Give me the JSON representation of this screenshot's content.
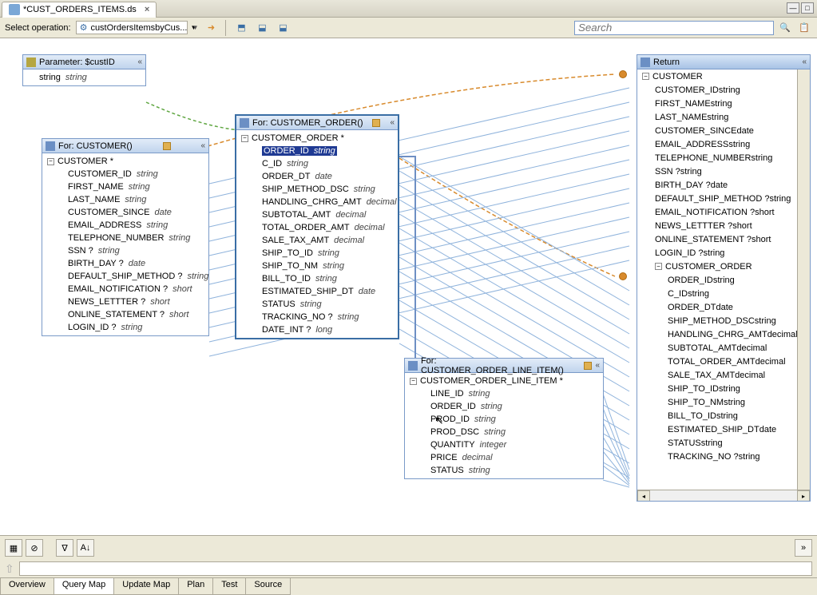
{
  "tab": {
    "title": "*CUST_ORDERS_ITEMS.ds"
  },
  "toolbar": {
    "select_label": "Select operation:",
    "operation": "custOrdersItemsbyCus...",
    "search_placeholder": "Search"
  },
  "panels": {
    "param": {
      "title": "Parameter: $custID",
      "rows": [
        {
          "name": "string",
          "type": "string"
        }
      ]
    },
    "customer": {
      "title": "For: CUSTOMER()",
      "root": "CUSTOMER *",
      "fields": [
        {
          "name": "CUSTOMER_ID",
          "type": "string"
        },
        {
          "name": "FIRST_NAME",
          "type": "string"
        },
        {
          "name": "LAST_NAME",
          "type": "string"
        },
        {
          "name": "CUSTOMER_SINCE",
          "type": "date"
        },
        {
          "name": "EMAIL_ADDRESS",
          "type": "string"
        },
        {
          "name": "TELEPHONE_NUMBER",
          "type": "string"
        },
        {
          "name": "SSN ?",
          "type": "string"
        },
        {
          "name": "BIRTH_DAY ?",
          "type": "date"
        },
        {
          "name": "DEFAULT_SHIP_METHOD ?",
          "type": "string"
        },
        {
          "name": "EMAIL_NOTIFICATION ?",
          "type": "short"
        },
        {
          "name": "NEWS_LETTTER ?",
          "type": "short"
        },
        {
          "name": "ONLINE_STATEMENT ?",
          "type": "short"
        },
        {
          "name": "LOGIN_ID ?",
          "type": "string"
        }
      ]
    },
    "order": {
      "title": "For: CUSTOMER_ORDER()",
      "root": "CUSTOMER_ORDER *",
      "fields": [
        {
          "name": "ORDER_ID",
          "type": "string",
          "selected": true
        },
        {
          "name": "C_ID",
          "type": "string"
        },
        {
          "name": "ORDER_DT",
          "type": "date"
        },
        {
          "name": "SHIP_METHOD_DSC",
          "type": "string"
        },
        {
          "name": "HANDLING_CHRG_AMT",
          "type": "decimal"
        },
        {
          "name": "SUBTOTAL_AMT",
          "type": "decimal"
        },
        {
          "name": "TOTAL_ORDER_AMT",
          "type": "decimal"
        },
        {
          "name": "SALE_TAX_AMT",
          "type": "decimal"
        },
        {
          "name": "SHIP_TO_ID",
          "type": "string"
        },
        {
          "name": "SHIP_TO_NM",
          "type": "string"
        },
        {
          "name": "BILL_TO_ID",
          "type": "string"
        },
        {
          "name": "ESTIMATED_SHIP_DT",
          "type": "date"
        },
        {
          "name": "STATUS",
          "type": "string"
        },
        {
          "name": "TRACKING_NO ?",
          "type": "string"
        },
        {
          "name": "DATE_INT ?",
          "type": "long"
        }
      ]
    },
    "lineitem": {
      "title": "For: CUSTOMER_ORDER_LINE_ITEM()",
      "root": "CUSTOMER_ORDER_LINE_ITEM *",
      "fields": [
        {
          "name": "LINE_ID",
          "type": "string"
        },
        {
          "name": "ORDER_ID",
          "type": "string"
        },
        {
          "name": "PROD_ID",
          "type": "string"
        },
        {
          "name": "PROD_DSC",
          "type": "string"
        },
        {
          "name": "QUANTITY",
          "type": "integer"
        },
        {
          "name": "PRICE",
          "type": "decimal"
        },
        {
          "name": "STATUS",
          "type": "string"
        }
      ]
    }
  },
  "return": {
    "title": "Return",
    "rows": [
      {
        "lvl": 0,
        "name": "CUSTOMER",
        "toggle": true
      },
      {
        "lvl": 1,
        "name": "CUSTOMER_ID",
        "type": "string"
      },
      {
        "lvl": 1,
        "name": "FIRST_NAME",
        "type": "string"
      },
      {
        "lvl": 1,
        "name": "LAST_NAME",
        "type": "string"
      },
      {
        "lvl": 1,
        "name": "CUSTOMER_SINCE",
        "type": "date"
      },
      {
        "lvl": 1,
        "name": "EMAIL_ADDRESS",
        "type": "string"
      },
      {
        "lvl": 1,
        "name": "TELEPHONE_NUMBER",
        "type": "string"
      },
      {
        "lvl": 1,
        "name": "SSN ?",
        "type": "string"
      },
      {
        "lvl": 1,
        "name": "BIRTH_DAY ?",
        "type": "date"
      },
      {
        "lvl": 1,
        "name": "DEFAULT_SHIP_METHOD ?",
        "type": "string"
      },
      {
        "lvl": 1,
        "name": "EMAIL_NOTIFICATION ?",
        "type": "short"
      },
      {
        "lvl": 1,
        "name": "NEWS_LETTTER ?",
        "type": "short"
      },
      {
        "lvl": 1,
        "name": "ONLINE_STATEMENT ?",
        "type": "short"
      },
      {
        "lvl": 1,
        "name": "LOGIN_ID ?",
        "type": "string"
      },
      {
        "lvl": 1,
        "name": "CUSTOMER_ORDER",
        "toggle": true
      },
      {
        "lvl": 2,
        "name": "ORDER_ID",
        "type": "string"
      },
      {
        "lvl": 2,
        "name": "C_ID",
        "type": "string"
      },
      {
        "lvl": 2,
        "name": "ORDER_DT",
        "type": "date"
      },
      {
        "lvl": 2,
        "name": "SHIP_METHOD_DSC",
        "type": "string"
      },
      {
        "lvl": 2,
        "name": "HANDLING_CHRG_AMT",
        "type": "decimal"
      },
      {
        "lvl": 2,
        "name": "SUBTOTAL_AMT",
        "type": "decimal"
      },
      {
        "lvl": 2,
        "name": "TOTAL_ORDER_AMT",
        "type": "decimal"
      },
      {
        "lvl": 2,
        "name": "SALE_TAX_AMT",
        "type": "decimal"
      },
      {
        "lvl": 2,
        "name": "SHIP_TO_ID",
        "type": "string"
      },
      {
        "lvl": 2,
        "name": "SHIP_TO_NM",
        "type": "string"
      },
      {
        "lvl": 2,
        "name": "BILL_TO_ID",
        "type": "string"
      },
      {
        "lvl": 2,
        "name": "ESTIMATED_SHIP_DT",
        "type": "date"
      },
      {
        "lvl": 2,
        "name": "STATUS",
        "type": "string"
      },
      {
        "lvl": 2,
        "name": "TRACKING_NO ?",
        "type": "string"
      }
    ]
  },
  "bottom_tabs": [
    "Overview",
    "Query Map",
    "Update Map",
    "Plan",
    "Test",
    "Source"
  ],
  "active_tab": "Query Map"
}
